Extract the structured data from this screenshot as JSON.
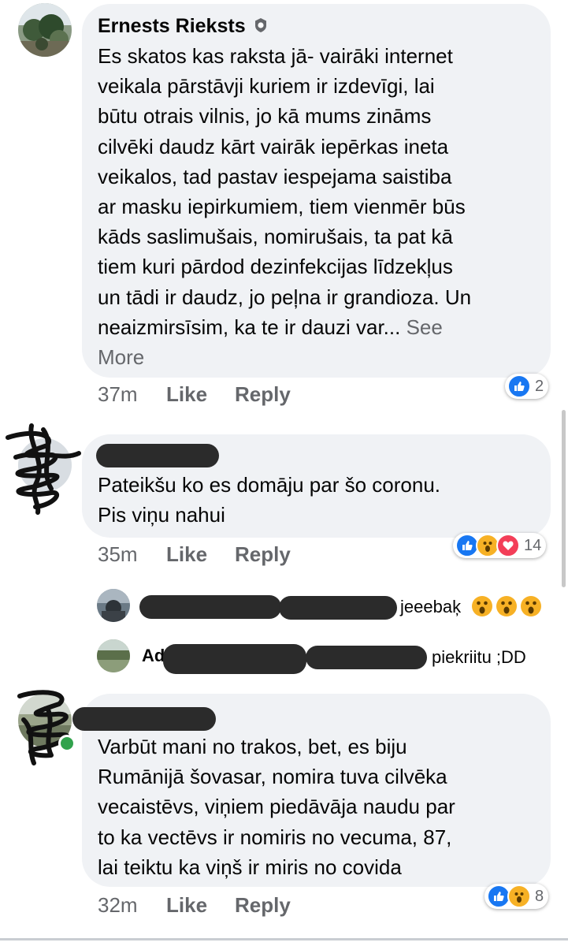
{
  "comments": [
    {
      "author": "Ernests Rieksts",
      "badge_icon": "top-fan-badge-icon",
      "text": "Es skatos kas raksta jā- vairāki internet\nveikala pārstāvji kuriem ir izdevīgi, lai\nbūtu otrais vilnis, jo kā mums zināms\ncilvēki daudz kārt vairāk iepērkas ineta\nveikalos, tad pastav iespejama saistiba\nar masku iepirkumiem, tiem vienmēr būs\nkāds saslimušais, nomirušais, ta pat kā\ntiem kuri pārdod dezinfekcijas līdzekļus\nun tādi ir daudz, jo peļna ir grandioza. Un\nneaizmirsīsim, ka te ir dauzi var...",
      "see_more": "See\nMore",
      "time": "37m",
      "like": "Like",
      "reply": "Reply",
      "reactions": [
        "like"
      ],
      "reaction_count": "2"
    },
    {
      "author": "",
      "text": "Pateikšu ko es domāju par šo coronu.\nPis viņu nahui",
      "time": "35m",
      "like": "Like",
      "reply": "Reply",
      "reactions": [
        "like",
        "wow",
        "love"
      ],
      "reaction_count": "14",
      "replies": [
        {
          "text": "jeeebaķ",
          "emojis": [
            "wow",
            "wow",
            "wow"
          ]
        },
        {
          "name_fragment": "Ad",
          "text": "piekriitu ;DD"
        }
      ]
    },
    {
      "author": "",
      "text": "Varbūt mani no trakos, bet, es biju\nRumānijā šovasar, nomira tuva cilvēka\nvecaistēvs, viņiem piedāvāja naudu par\nto ka vectēvs ir nomiris no vecuma, 87,\nlai teiktu ka viņš ir miris no covida",
      "time": "32m",
      "like": "Like",
      "reply": "Reply",
      "reactions": [
        "like",
        "wow"
      ],
      "reaction_count": "8"
    }
  ],
  "colors": {
    "bubble": "#f0f2f5",
    "link_gray": "#65676b",
    "like_blue": "#1877f2",
    "wow_yellow": "#f7b125",
    "love_red": "#f33e58",
    "online_green": "#31a24c"
  }
}
